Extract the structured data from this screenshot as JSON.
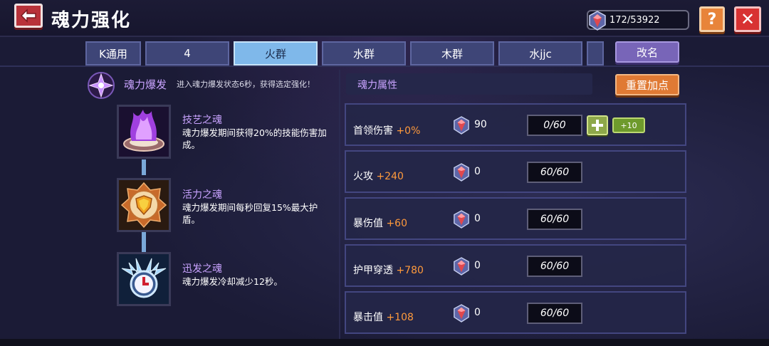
{
  "header": {
    "title": "魂力强化",
    "currency_value": "172/53922",
    "help_label": "?",
    "close_label": "✕"
  },
  "tabs": [
    {
      "label": "K通用",
      "active": false
    },
    {
      "label": "4",
      "active": false
    },
    {
      "label": "火群",
      "active": true
    },
    {
      "label": "水群",
      "active": false
    },
    {
      "label": "木群",
      "active": false
    },
    {
      "label": "水jjc",
      "active": false
    },
    {
      "label": "",
      "active": false
    }
  ],
  "rename_label": "改名",
  "burst": {
    "title": "魂力爆发",
    "description": "进入魂力爆发状态6秒，获得选定强化！"
  },
  "souls": [
    {
      "name": "技艺之魂",
      "description": "魂力爆发期间获得20%的技能伤害加成。",
      "icon": "purple-flame-icon"
    },
    {
      "name": "活力之魂",
      "description": "魂力爆发期间每秒回复15%最大护盾。",
      "icon": "golden-shield-icon"
    },
    {
      "name": "迅发之魂",
      "description": "魂力爆发冷却减少12秒。",
      "icon": "clock-wings-icon"
    }
  ],
  "attributes": {
    "header": "魂力属性",
    "reset_label": "重置加点",
    "rows": [
      {
        "label": "首领伤害",
        "bonus": "+0%",
        "cost": "90",
        "progress": "0/60",
        "plus_label": "+",
        "plus10_label": "+10"
      },
      {
        "label": "火攻",
        "bonus": "+240",
        "cost": "0",
        "progress": "60/60"
      },
      {
        "label": "暴伤值",
        "bonus": "+60",
        "cost": "0",
        "progress": "60/60"
      },
      {
        "label": "护甲穿透",
        "bonus": "+780",
        "cost": "0",
        "progress": "60/60"
      },
      {
        "label": "暴击值",
        "bonus": "+108",
        "cost": "0",
        "progress": "60/60"
      }
    ]
  },
  "colors": {
    "accent_purple": "#c9a3ff",
    "bonus_orange": "#ff9a3c",
    "active_tab": "#7fb8ea",
    "close_red": "#d83232",
    "help_orange": "#e8843a"
  }
}
